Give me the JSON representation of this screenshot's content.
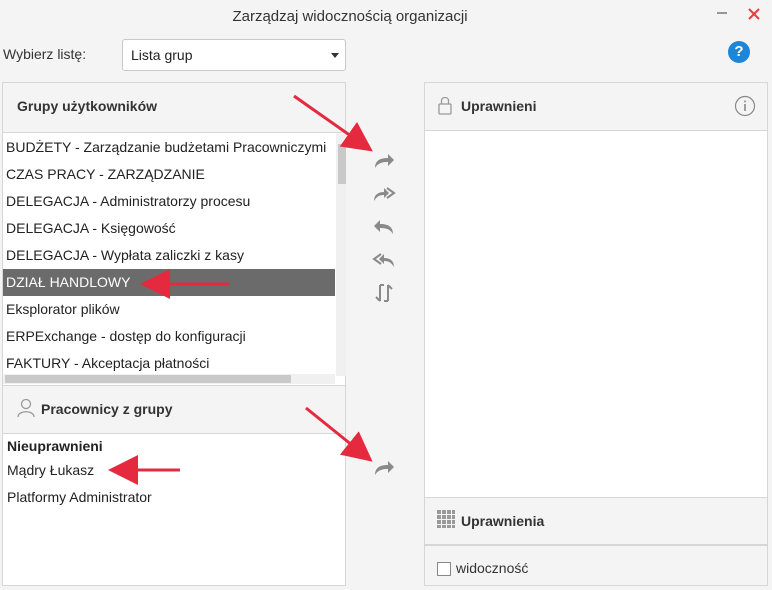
{
  "window": {
    "title": "Zarządzaj widocznością organizacji"
  },
  "selector": {
    "label": "Wybierz listę:",
    "value": "Lista grup"
  },
  "groups": {
    "header": "Grupy użytkowników",
    "items": [
      "BUDŻETY - Zarządzanie budżetami Pracowniczymi",
      "CZAS PRACY - ZARZĄDZANIE",
      "DELEGACJA - Administratorzy procesu",
      "DELEGACJA - Księgowość",
      "DELEGACJA - Wypłata zaliczki z kasy",
      "DZIAŁ HANDLOWY",
      "Eksplorator plików",
      "ERPExchange - dostęp do konfiguracji",
      "FAKTURY - Akceptacja płatności"
    ],
    "selected_index": 5
  },
  "workers": {
    "header": "Pracownicy z grupy",
    "section": "Nieuprawnieni",
    "items": [
      "Mądry Łukasz",
      "Platformy Administrator"
    ]
  },
  "permissions": {
    "header": "Uprawnieni",
    "rights_header": "Uprawnienia",
    "checkbox_label": "widoczność",
    "checkbox_checked": false
  },
  "colors": {
    "accent": "#1d86d9",
    "annotation": "#e5293f",
    "selected_bg": "#6b6b6b"
  }
}
